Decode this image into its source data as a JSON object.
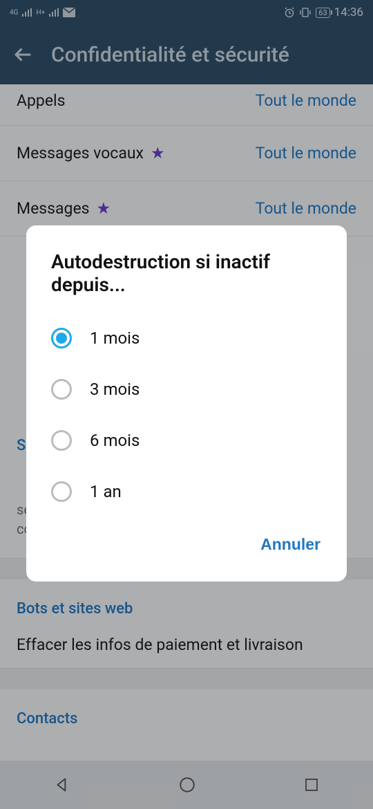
{
  "statusbar": {
    "network_label": "4G",
    "network2_label": "H+",
    "battery": "63",
    "time": "14:36"
  },
  "appbar": {
    "title": "Confidentialité et sécurité"
  },
  "rows": {
    "calls_label": "Appels",
    "calls_value": "Tout le monde",
    "voice_label": "Messages vocaux",
    "voice_value": "Tout le monde",
    "messages_label": "Messages",
    "messages_value": "Tout le monde"
  },
  "sections": {
    "delete_title": "S",
    "delete_desc_partial": "sera supprimé, ainsi que tous vos messages et contacts.",
    "bots_title": "Bots et sites web",
    "bots_row": "Effacer les infos de paiement et livraison",
    "contacts_title": "Contacts"
  },
  "dialog": {
    "title": "Autodestruction si inactif depuis...",
    "options": [
      "1 mois",
      "3 mois",
      "6 mois",
      "1 an"
    ],
    "selected_index": 0,
    "cancel": "Annuler"
  }
}
